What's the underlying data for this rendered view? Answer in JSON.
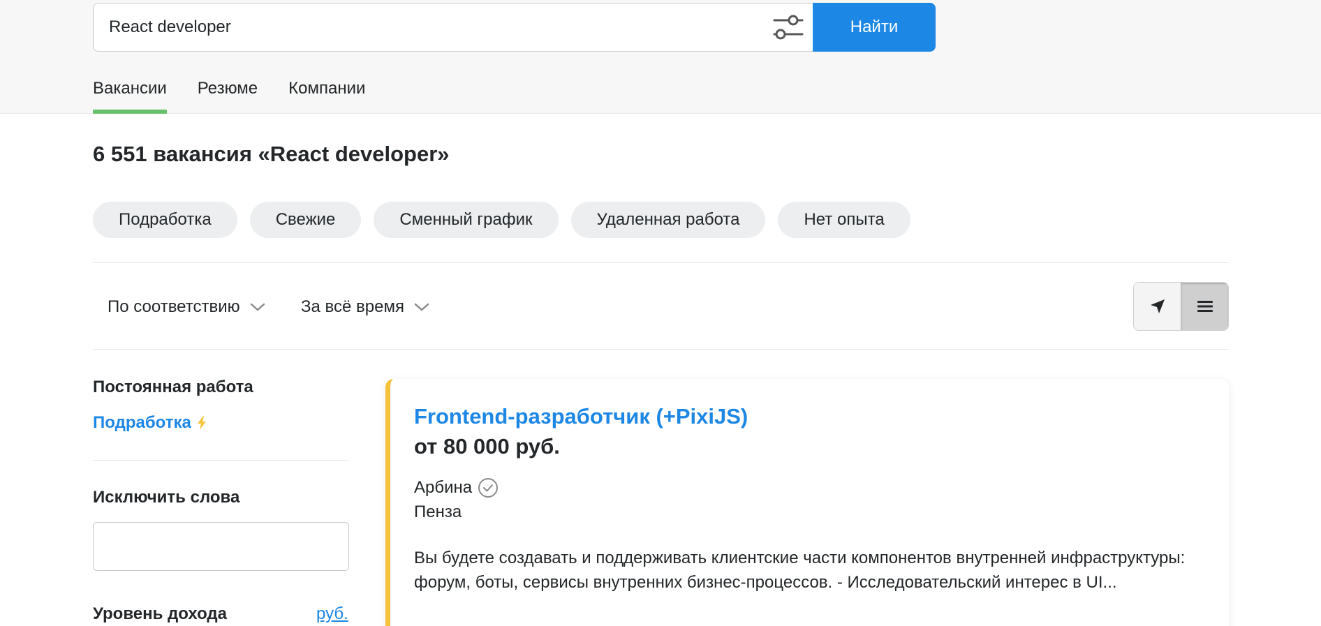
{
  "search": {
    "query": "React developer",
    "button_label": "Найти"
  },
  "tabs": [
    {
      "label": "Вакансии",
      "active": true
    },
    {
      "label": "Резюме",
      "active": false
    },
    {
      "label": "Компании",
      "active": false
    }
  ],
  "results": {
    "title": "6 551 вакансия «React developer»"
  },
  "chips": [
    {
      "label": "Подработка"
    },
    {
      "label": "Свежие"
    },
    {
      "label": "Сменный график"
    },
    {
      "label": "Удаленная работа"
    },
    {
      "label": "Нет опыта"
    }
  ],
  "sort": {
    "order_label": "По соответствию",
    "period_label": "За всё время"
  },
  "sidebar": {
    "employment_heading": "Постоянная работа",
    "parttime_link": "Подработка",
    "exclude_heading": "Исключить слова",
    "exclude_value": "",
    "income_heading": "Уровень дохода",
    "currency_link": "руб."
  },
  "vacancy": {
    "title": "Frontend-разработчик (+PixiJS)",
    "salary": "от 80 000 руб.",
    "company": "Арбина",
    "city": "Пенза",
    "description": "Вы будете создавать и поддерживать клиентские части компонентов внутренней инфраструктуры: форум, боты, сервисы внутренних бизнес-процессов. - Исследовательский интерес в UI..."
  },
  "colors": {
    "accent_blue": "#1d87e5",
    "tab_underline_green": "#67c16b",
    "card_highlight_yellow": "#f5c33b",
    "lightning_yellow": "#f5c33b"
  },
  "icons": {
    "filter": "sliders-icon",
    "chevron": "chevron-down-icon",
    "map_view": "navigation-arrow-icon",
    "list_view": "list-lines-icon",
    "verified": "verified-check-icon",
    "lightning": "lightning-icon"
  }
}
